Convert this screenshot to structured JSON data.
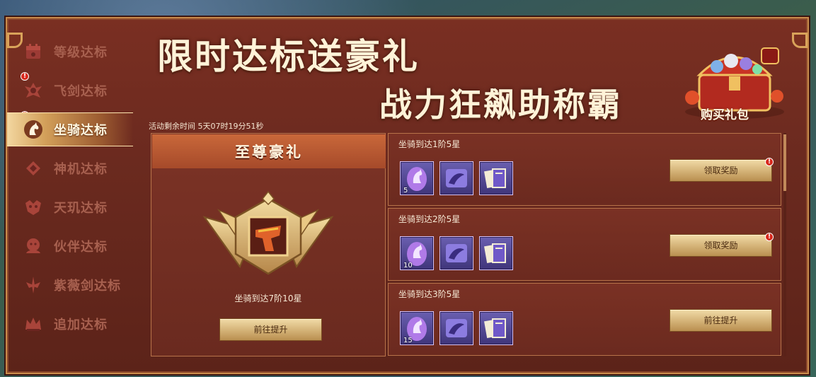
{
  "sidebar": {
    "items": [
      {
        "label": "等级达标"
      },
      {
        "label": "飞剑达标"
      },
      {
        "label": "坐骑达标"
      },
      {
        "label": "神机达标"
      },
      {
        "label": "天玑达标"
      },
      {
        "label": "伙伴达标"
      },
      {
        "label": "紫薇剑达标"
      },
      {
        "label": "追加达标"
      }
    ],
    "active_index": 2
  },
  "banner": {
    "line1": "限时达标送豪礼",
    "line2": "战力狂飙助称霸",
    "gift_label": "购买礼包"
  },
  "timer": "活动剩余时间  5天07时19分51秒",
  "supreme": {
    "header": "至尊豪礼",
    "requirement": "坐骑到达7阶10星",
    "button": "前往提升"
  },
  "tasks": [
    {
      "title": "坐骑到达1阶5星",
      "items": [
        {
          "icon": "mount-egg-icon",
          "count": "5"
        },
        {
          "icon": "scroll-icon",
          "count": ""
        },
        {
          "icon": "book-icon",
          "count": ""
        }
      ],
      "button": "领取奖励",
      "badge": "!"
    },
    {
      "title": "坐骑到达2阶5星",
      "items": [
        {
          "icon": "mount-egg-icon",
          "count": "10"
        },
        {
          "icon": "scroll-icon",
          "count": ""
        },
        {
          "icon": "book-icon",
          "count": ""
        }
      ],
      "button": "领取奖励",
      "badge": "!"
    },
    {
      "title": "坐骑到达3阶5星",
      "items": [
        {
          "icon": "mount-egg-icon",
          "count": "15"
        },
        {
          "icon": "scroll-icon",
          "count": ""
        },
        {
          "icon": "book-icon",
          "count": ""
        }
      ],
      "button": "前往提升",
      "badge": ""
    }
  ],
  "colors": {
    "panel_bg": "#6b2a1f",
    "border": "#b8734a",
    "gold_button": "#d6b57a",
    "active_tab": "#d3a05a",
    "item_bg": "#4f449a",
    "red_dot": "#d8281c"
  }
}
